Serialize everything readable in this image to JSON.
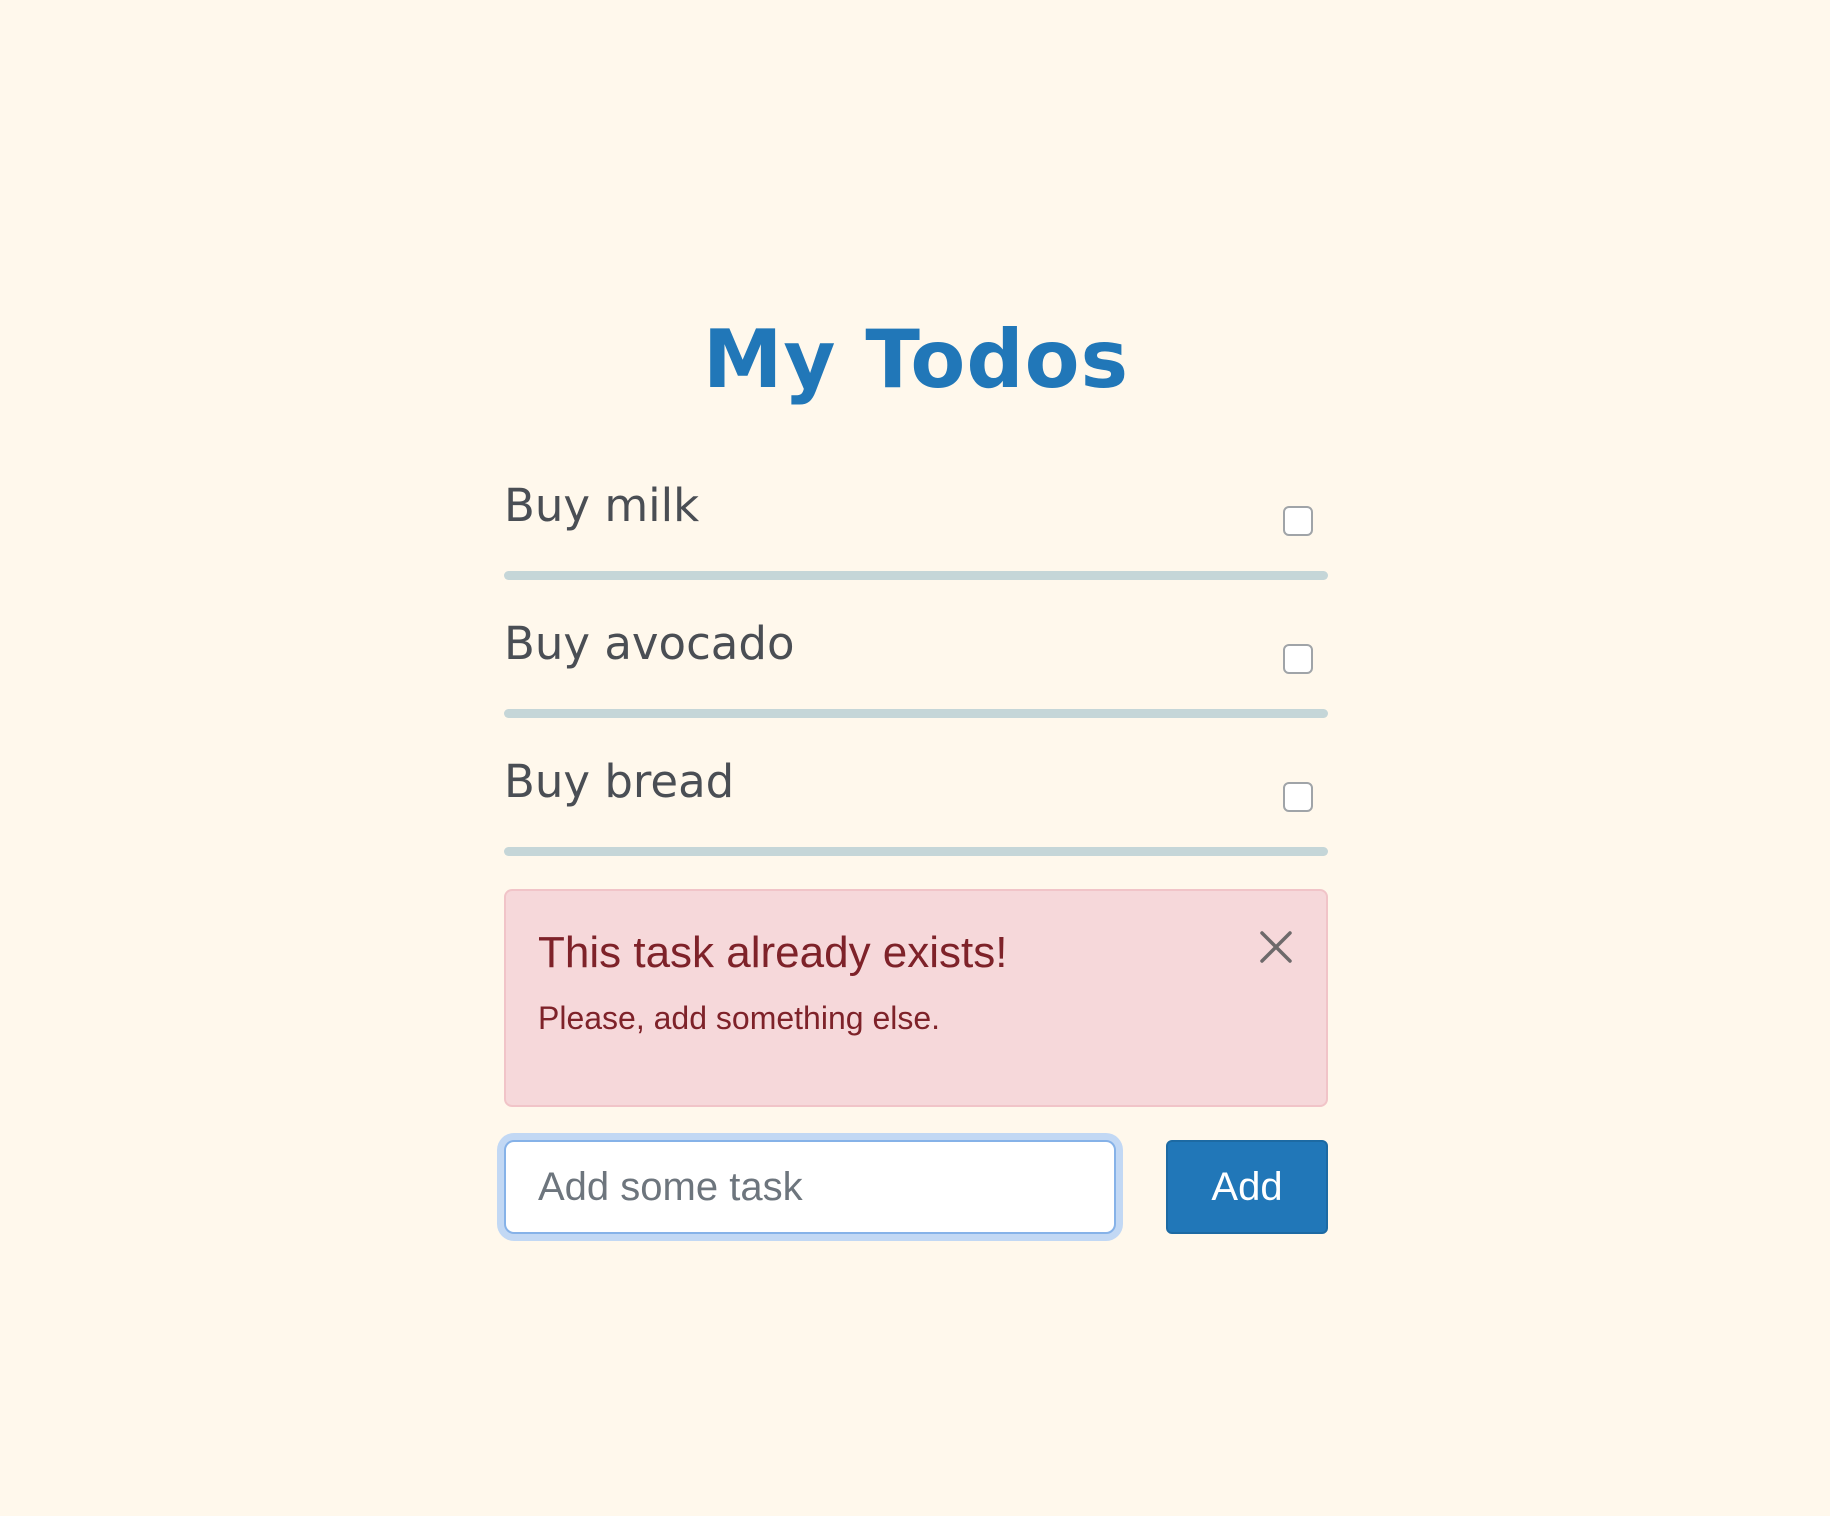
{
  "app": {
    "title": "My Todos"
  },
  "todos": [
    {
      "label": "Buy milk",
      "checked": false
    },
    {
      "label": "Buy avocado",
      "checked": false
    },
    {
      "label": "Buy bread",
      "checked": false
    }
  ],
  "alert": {
    "heading": "This task already exists!",
    "message": "Please, add something else.",
    "close_icon": "close-icon"
  },
  "add_form": {
    "placeholder": "Add some task",
    "value": "",
    "button_label": "Add"
  },
  "colors": {
    "background": "#fff8ec",
    "accent": "#2177b8",
    "alert_background": "#f6d8da",
    "alert_text": "#7e2229",
    "divider": "#c5d6d8"
  }
}
